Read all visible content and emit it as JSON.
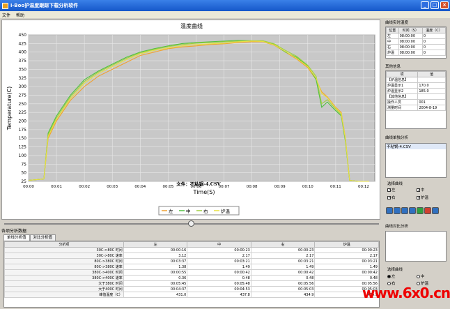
{
  "window": {
    "title": "i-Boo护温度跟踪下载分析软件"
  },
  "menu": [
    "文件",
    "帮助"
  ],
  "chart_data": {
    "type": "line",
    "title": "温度曲线",
    "xlabel": "Time(S)",
    "ylabel": "Temperature(C)",
    "file_label": "文件：不粘锅-4.CSV",
    "x_ticks": [
      "00:00",
      "00:01",
      "00:02",
      "00:03",
      "00:04",
      "00:05",
      "00:06",
      "00:07",
      "00:08",
      "00:09",
      "00:10",
      "00:11",
      "00:12"
    ],
    "y_ticks": [
      25,
      50,
      75,
      100,
      125,
      150,
      175,
      200,
      225,
      250,
      275,
      300,
      325,
      350,
      375,
      400,
      425,
      450
    ],
    "ylim": [
      25,
      450
    ],
    "xlim": [
      0,
      12.4
    ],
    "grid": true,
    "legend_text": [
      "左",
      "中",
      "右",
      "炉温"
    ],
    "series": [
      {
        "name": "左",
        "color": "#f0a030",
        "x": [
          0,
          0.3,
          0.55,
          0.7,
          1,
          1.5,
          2,
          2.5,
          3,
          3.5,
          4,
          4.5,
          5,
          5.5,
          6,
          6.5,
          7,
          7.5,
          8,
          8.4,
          8.8,
          9.2,
          9.6,
          10,
          10.3,
          10.5,
          10.7,
          11,
          11.2,
          11.35,
          11.5,
          11.8,
          12.2
        ],
        "y": [
          28,
          30,
          32,
          150,
          200,
          260,
          300,
          330,
          350,
          370,
          390,
          400,
          410,
          415,
          418,
          422,
          424,
          428,
          430,
          430,
          420,
          400,
          380,
          355,
          320,
          285,
          270,
          240,
          225,
          150,
          28,
          25,
          25
        ]
      },
      {
        "name": "中",
        "color": "#50c040",
        "x": [
          0,
          0.3,
          0.55,
          0.7,
          1,
          1.5,
          2,
          2.5,
          3,
          3.5,
          4,
          4.5,
          5,
          5.5,
          6,
          6.5,
          7,
          7.5,
          8,
          8.4,
          8.8,
          9.2,
          9.6,
          10,
          10.3,
          10.5,
          10.7,
          11,
          11.2,
          11.35,
          11.5,
          11.8,
          12.2
        ],
        "y": [
          28,
          30,
          32,
          165,
          215,
          275,
          320,
          345,
          365,
          385,
          400,
          410,
          418,
          425,
          428,
          430,
          432,
          434,
          433,
          432,
          422,
          400,
          385,
          360,
          320,
          240,
          255,
          230,
          215,
          140,
          28,
          25,
          25
        ]
      },
      {
        "name": "右",
        "color": "#a0d040",
        "x": [
          0,
          0.3,
          0.55,
          0.7,
          1,
          1.5,
          2,
          2.5,
          3,
          3.5,
          4,
          4.5,
          5,
          5.5,
          6,
          6.5,
          7,
          7.5,
          8,
          8.4,
          8.8,
          9.2,
          9.6,
          10,
          10.3,
          10.5,
          10.7,
          11,
          11.2,
          11.35,
          11.5,
          11.8,
          12.2
        ],
        "y": [
          28,
          30,
          32,
          160,
          210,
          270,
          315,
          342,
          362,
          382,
          398,
          408,
          416,
          422,
          426,
          428,
          430,
          432,
          433,
          433,
          424,
          405,
          388,
          362,
          330,
          250,
          262,
          235,
          218,
          145,
          28,
          25,
          25
        ]
      },
      {
        "name": "炉温",
        "color": "#e8e040",
        "x": [
          0,
          0.3,
          0.55,
          0.7,
          1,
          1.5,
          2,
          2.5,
          3,
          3.5,
          4,
          4.5,
          5,
          5.5,
          6,
          6.5,
          7,
          7.5,
          8,
          8.4,
          8.8,
          9.2,
          9.6,
          10,
          10.3,
          10.5,
          10.7,
          11,
          11.2,
          11.35,
          11.5,
          11.8,
          12.2
        ],
        "y": [
          28,
          30,
          32,
          155,
          205,
          265,
          310,
          338,
          358,
          378,
          395,
          405,
          412,
          418,
          422,
          424,
          426,
          430,
          432,
          431,
          421,
          402,
          382,
          358,
          325,
          280,
          268,
          238,
          222,
          148,
          28,
          25,
          25
        ]
      }
    ]
  },
  "analysis": {
    "title": "各项分析数据",
    "tabs": [
      "单线分析值",
      "对比分析值"
    ],
    "columns": [
      "分析项",
      "左",
      "中",
      "右",
      "炉温"
    ],
    "rows": [
      [
        "30C->80C 时间",
        "00:00:16",
        "00:00:23",
        "00:00:23",
        "00:00:23"
      ],
      [
        "30C->80C 速率",
        "3.12",
        "2.17",
        "2.17",
        "2.17"
      ],
      [
        "80C->380C 时间",
        "00:03:37",
        "00:03:21",
        "00:03:21",
        "00:03:21"
      ],
      [
        "80C->380C 速率",
        "1.38",
        "1.49",
        "1.49",
        "1.49"
      ],
      [
        "380C->400C 时间",
        "00:00:55",
        "00:00:42",
        "00:00:42",
        "00:00:42"
      ],
      [
        "380C->400C 速率",
        "0.36",
        "0.48",
        "0.48",
        "0.48"
      ],
      [
        "大于380C 时间",
        "00:05:45",
        "00:05:48",
        "00:05:56",
        "00:05:56"
      ],
      [
        "大于400C 时间",
        "00:04:37",
        "00:04:53",
        "00:05:03",
        "00:05:03"
      ],
      [
        "峰值温度（C）",
        "431.0",
        "437.8",
        "434.9",
        "434.9"
      ]
    ]
  },
  "realtime": {
    "title": "曲线实时温度",
    "columns": [
      "位置",
      "时间（S）",
      "温度（C）"
    ],
    "rows": [
      [
        "左",
        "08:00:00",
        "0"
      ],
      [
        "中",
        "08:00:00",
        "0"
      ],
      [
        "右",
        "08:00:00",
        "0"
      ],
      [
        "炉温",
        "08:00:00",
        "0"
      ]
    ]
  },
  "other_info": {
    "title": "其他信息",
    "columns": [
      "项",
      "值"
    ],
    "rows": [
      [
        "【炉温信息】",
        ""
      ],
      [
        "炉温显示1",
        "170.0"
      ],
      [
        "炉温显示2",
        "185.0"
      ],
      [
        "【其他信息】",
        ""
      ],
      [
        "操作人员",
        "001"
      ],
      [
        "测量时间",
        "2004-8-19"
      ]
    ]
  },
  "single_analysis": {
    "title": "曲线单独分析",
    "items": [
      "不粘锅-4.CSV"
    ]
  },
  "select_curve": {
    "title": "选择曲线",
    "options": [
      "左",
      "中",
      "右",
      "炉温"
    ]
  },
  "compare": {
    "title": "曲线对比分析"
  },
  "select_curve2": {
    "title": "选择曲线",
    "options": [
      "左",
      "中",
      "右",
      "炉温"
    ],
    "selected": "左"
  },
  "watermark": "www.6x0.cn"
}
